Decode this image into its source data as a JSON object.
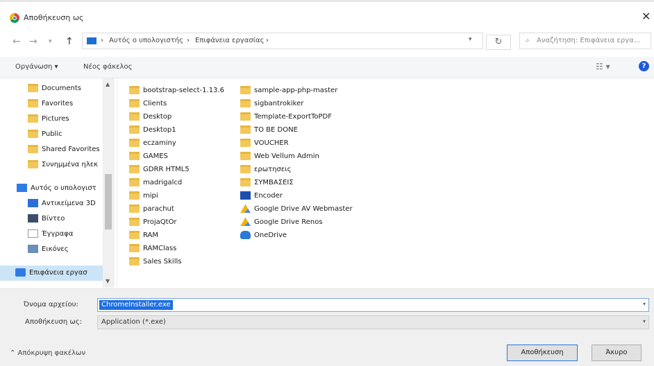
{
  "window": {
    "title": "Αποθήκευση ως",
    "close_glyph": "✕"
  },
  "address": {
    "back_glyph": "←",
    "forward_glyph": "→",
    "up_glyph": "↑",
    "breadcrumbs": [
      "Αυτός ο υπολογιστής",
      "Επιφάνεια εργασίας"
    ],
    "separator": "›",
    "refresh_glyph": "↻",
    "search_placeholder": "Αναζήτηση: Επιφάνεια εργα..."
  },
  "toolbar": {
    "organize": "Οργάνωση ▾",
    "new_folder": "Νέος φάκελος",
    "view_glyph": "☷ ▾",
    "help_glyph": "?"
  },
  "nav_pane": {
    "items": [
      {
        "label": "Documents",
        "icon": "folder-icon"
      },
      {
        "label": "Favorites",
        "icon": "folder-icon"
      },
      {
        "label": "Pictures",
        "icon": "folder-icon"
      },
      {
        "label": "Public",
        "icon": "folder-icon"
      },
      {
        "label": "Shared Favorites",
        "icon": "folder-icon"
      },
      {
        "label": "Συνημμένα ηλεκ",
        "icon": "folder-icon"
      },
      {
        "label": "Αυτός ο υπολογιστ",
        "icon": "computer-icon"
      },
      {
        "label": "Αντικείμενα 3D",
        "icon": "cube-3d-icon"
      },
      {
        "label": "Βίντεο",
        "icon": "video-icon"
      },
      {
        "label": "Έγγραφα",
        "icon": "document-icon"
      },
      {
        "label": "Εικόνες",
        "icon": "pictures-icon"
      },
      {
        "label": "Επιφάνεια εργασ",
        "icon": "desktop-icon",
        "selected": true
      }
    ]
  },
  "files": {
    "col1": [
      "bootstrap-select-1.13.6",
      "Clients",
      "Desktop",
      "Desktop1",
      "eczaminy",
      "GAMES",
      "GDRR HTML5",
      "madrigalcd",
      "mipi",
      "parachut",
      "ProjaQtOr",
      "RAM",
      "RAMClass",
      "Sales Skills"
    ],
    "col2": [
      {
        "label": "sample-app-php-master",
        "icon": "folder-icon"
      },
      {
        "label": "sigbantrokiker",
        "icon": "folder-icon"
      },
      {
        "label": "Template-ExportToPDF",
        "icon": "folder-icon"
      },
      {
        "label": "TO BE DONE",
        "icon": "folder-icon"
      },
      {
        "label": "VOUCHER",
        "icon": "folder-icon"
      },
      {
        "label": "Web Vellum Admin",
        "icon": "folder-icon"
      },
      {
        "label": "ερωτησεις",
        "icon": "folder-icon"
      },
      {
        "label": "ΣΥΜΒΑΣΕΙΣ",
        "icon": "folder-icon"
      },
      {
        "label": "Encoder",
        "icon": "app-icon"
      },
      {
        "label": "Google Drive AV Webmaster",
        "icon": "google-drive-icon"
      },
      {
        "label": "Google Drive Renos",
        "icon": "google-drive-icon"
      },
      {
        "label": "OneDrive",
        "icon": "onedrive-icon"
      }
    ]
  },
  "fields": {
    "filename_label": "Όνομα αρχείου:",
    "filename_value": "ChromeInstaller.exe",
    "type_label": "Αποθήκευση ως:",
    "type_value": "Application (*.exe)"
  },
  "footer": {
    "hide_folders": "⌃  Απόκρυψη φακέλων",
    "save": "Αποθήκευση",
    "cancel": "Άκυρο"
  }
}
